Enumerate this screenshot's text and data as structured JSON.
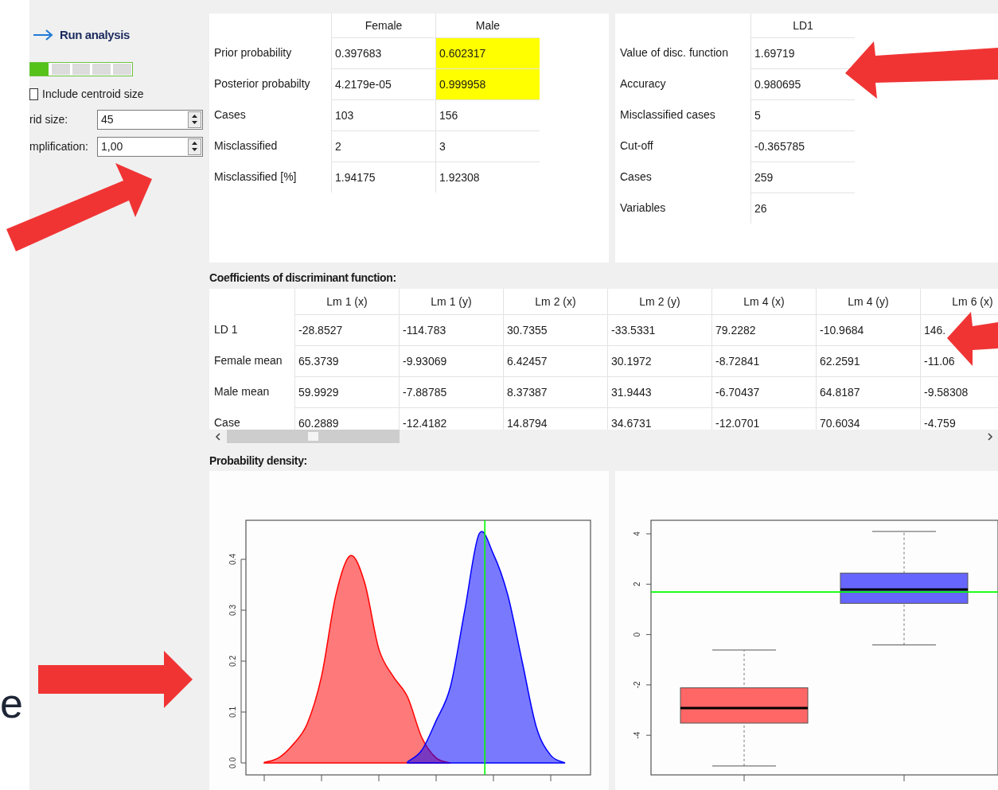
{
  "edge_text": "e",
  "sidebar": {
    "run_button": "Run analysis",
    "progress": {
      "level": 0.2
    },
    "checkbox": {
      "label": "Include centroid size",
      "checked": false
    },
    "fields": [
      {
        "label": "rid size:",
        "value": "45"
      },
      {
        "label": "mplification:",
        "value": "1,00"
      }
    ]
  },
  "class_table": {
    "columns": [
      "Female",
      "Male"
    ],
    "rows": [
      {
        "label": "Prior probability",
        "cells": [
          {
            "text": "0.397683",
            "highlighted": false
          },
          {
            "text": "0.602317",
            "highlighted": true
          }
        ]
      },
      {
        "label": "Posterior probabilty",
        "cells": [
          {
            "text": "4.2179e-05",
            "highlighted": false
          },
          {
            "text": "0.999958",
            "highlighted": true
          }
        ]
      },
      {
        "label": "Cases",
        "cells": [
          {
            "text": "103",
            "highlighted": false
          },
          {
            "text": "156",
            "highlighted": false
          }
        ]
      },
      {
        "label": "Misclassified",
        "cells": [
          {
            "text": "2",
            "highlighted": false
          },
          {
            "text": "3",
            "highlighted": false
          }
        ]
      },
      {
        "label": "Misclassified [%]",
        "cells": [
          {
            "text": "1.94175",
            "highlighted": false
          },
          {
            "text": "1.92308",
            "highlighted": false
          }
        ]
      }
    ]
  },
  "discriminant_table": {
    "columns": [
      "LD1"
    ],
    "rows": [
      {
        "label": "Value of disc. function",
        "value": "1.69719"
      },
      {
        "label": "Accuracy",
        "value": "0.980695"
      },
      {
        "label": "Misclassified cases",
        "value": "5"
      },
      {
        "label": "Cut-off",
        "value": "-0.365785"
      },
      {
        "label": "Cases",
        "value": "259"
      },
      {
        "label": "Variables",
        "value": "26"
      }
    ]
  },
  "coefficients": {
    "title": "Coefficients of discriminant function:",
    "columns": [
      "Lm 1 (x)",
      "Lm 1 (y)",
      "Lm 2 (x)",
      "Lm 2 (y)",
      "Lm 4 (x)",
      "Lm 4 (y)",
      "Lm 6 (x)"
    ],
    "rows": [
      {
        "label": "LD 1",
        "cells": [
          "-28.8527",
          "-114.783",
          "30.7355",
          "-33.5331",
          "79.2282",
          "-10.9684",
          "146."
        ]
      },
      {
        "label": "Female mean",
        "cells": [
          "65.3739",
          "-9.93069",
          "6.42457",
          "30.1972",
          "-8.72841",
          "62.2591",
          "-11.06"
        ]
      },
      {
        "label": "Male mean",
        "cells": [
          "59.9929",
          "-7.88785",
          "8.37387",
          "31.9443",
          "-6.70437",
          "64.8187",
          "-9.58308"
        ]
      },
      {
        "label": "Case",
        "cells": [
          "60.2889",
          "-12.4182",
          "14.8794",
          "34.6731",
          "-12.0701",
          "70.6034",
          "-4.759"
        ]
      }
    ]
  },
  "density": {
    "title": "Probability density:",
    "yticks": [
      "0.0",
      "0.1",
      "0.2",
      "0.3",
      "0.4"
    ]
  },
  "boxplot": {
    "yticks": [
      "4",
      "2",
      "0",
      "-2",
      "-4"
    ]
  }
}
